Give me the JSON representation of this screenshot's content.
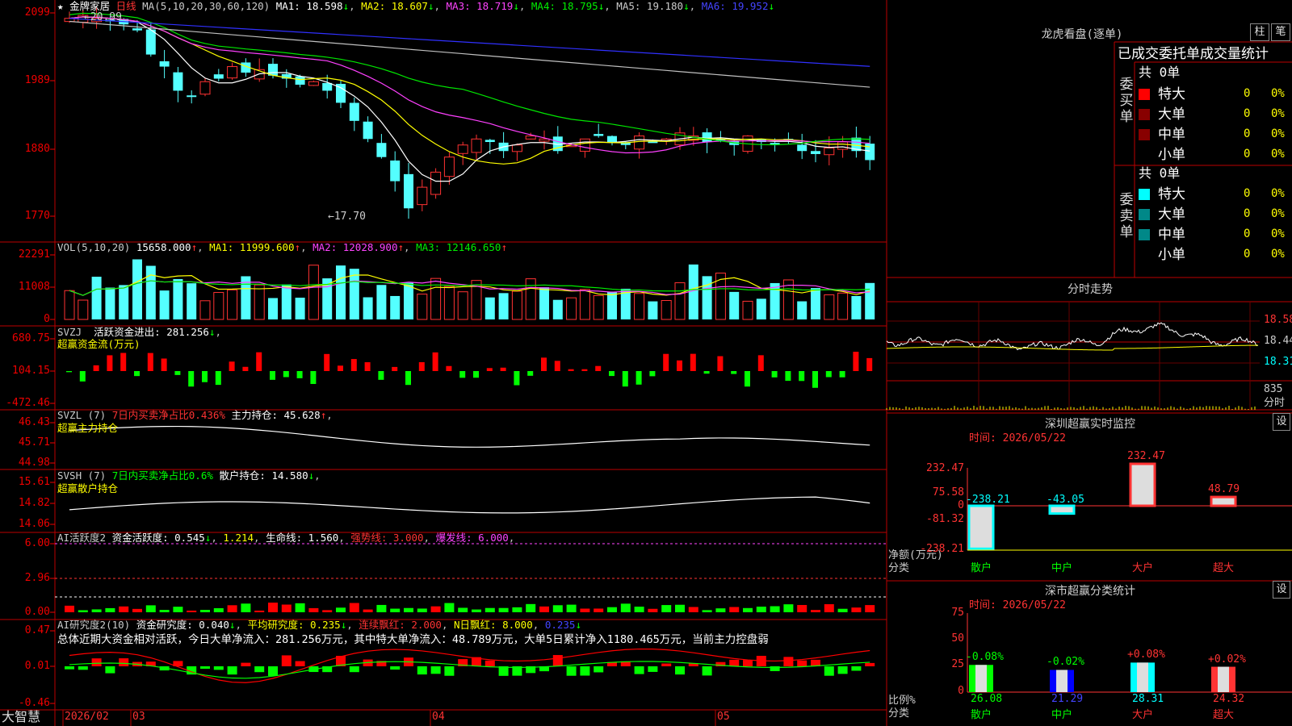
{
  "stock": {
    "name": "金牌家居",
    "period": "日线"
  },
  "main_legend": {
    "label": "MA(5,10,20,30,60,120)",
    "ma1": "MA1: 18.598",
    "ma2": "MA2: 18.607",
    "ma3": "MA3: 18.719",
    "ma4": "MA4: 18.795",
    "ma5": "MA5: 19.180",
    "ma6": "MA6: 19.952"
  },
  "price_axis": [
    "2099",
    "1989",
    "1880",
    "1770"
  ],
  "price_marks": {
    "high": "20.99",
    "low": "17.70"
  },
  "vol_legend": {
    "label": "VOL(5,10,20)",
    "value": "15658.000",
    "ma1": "MA1: 11999.600",
    "ma2": "MA2: 12028.900",
    "ma3": "MA3: 12146.650"
  },
  "vol_axis": [
    "22291",
    "11008",
    "0"
  ],
  "svzj": {
    "label": "SVZJ",
    "desc": "活跃资金进出: 281.256",
    "sub": "超赢资金流(万元)",
    "axis": [
      "680.75",
      "104.15",
      "-472.46"
    ]
  },
  "svzl": {
    "label": "SVZL (7)",
    "desc1": "7日内买卖净占比0.436%",
    "desc2": "主力持仓: 45.628",
    "sub": "超赢主力持仓",
    "axis": [
      "46.43",
      "45.71",
      "44.98"
    ]
  },
  "svsh": {
    "label": "SVSH (7)",
    "desc1": "7日内买卖净占比0.6%",
    "desc2": "散户持仓: 14.580",
    "sub": "超赢散户持仓",
    "axis": [
      "15.61",
      "14.82",
      "14.06"
    ]
  },
  "ai_active": {
    "label": "AI活跃度2",
    "desc1": "资金活跃度: 0.545",
    "desc2": "1.214",
    "desc3": "生命线: 1.560",
    "desc4": "强势线: 3.000",
    "desc5": "爆发线: 6.000",
    "axis": [
      "6.00",
      "2.96",
      "0.00"
    ]
  },
  "ai_research": {
    "label": "AI研究度2(10)",
    "desc1": "资金研究度: 0.040",
    "desc2": "平均研究度: 0.235",
    "desc3": "连续飘红: 2.000",
    "desc4": "N日飘红: 8.000",
    "desc5": "0.235",
    "summary": "总体近期大资金相对活跃，今日大单净流入：281.256万元，其中特大单净流入：48.789万元，大单5日累计净入1180.465万元，当前主力控盘弱",
    "axis": [
      "0.47",
      "0.01",
      "-0.46"
    ]
  },
  "bottom": {
    "brand": "大智慧",
    "date": "2026/02",
    "m03": "03",
    "m04": "04",
    "m05": "05"
  },
  "longhu": {
    "title": "龙虎看盘(逐单)",
    "btn1": "柱",
    "btn2": "笔",
    "header": "已成交委托单成交量统计",
    "buy_label": "委买单",
    "sell_label": "委卖单",
    "buy_total": "共 0单",
    "sell_total": "共 0单",
    "rows": [
      "特大",
      "大单",
      "中单",
      "小单"
    ],
    "zero": "0",
    "pct": "0%"
  },
  "fenshi": {
    "title": "分时走势",
    "axis": [
      "18.58",
      "18.44",
      "18.31"
    ],
    "vol_label": "835",
    "vol_unit": "分时"
  },
  "monitor": {
    "title": "深圳超赢实时监控",
    "btn": "设",
    "time": "时间: 2026/05/22",
    "axis": [
      "232.47",
      "75.58",
      "0",
      "-81.32",
      "-238.21"
    ],
    "unit": "净额(万元)",
    "xlabel": "分类"
  },
  "classify": {
    "title": "深市超赢分类统计",
    "btn": "设",
    "time": "时间: 2026/05/22",
    "axis": [
      "75",
      "50",
      "25",
      "0"
    ],
    "unit": "比例%",
    "xlabel": "分类"
  },
  "chart_data": [
    {
      "type": "bar",
      "title": "深圳超赢实时监控",
      "categories": [
        "散户",
        "中户",
        "大户",
        "超大"
      ],
      "values": [
        -238.21,
        -43.05,
        232.47,
        48.79
      ],
      "ylim": [
        -238.21,
        232.47
      ]
    },
    {
      "type": "bar",
      "title": "深市超赢分类统计",
      "categories": [
        "散户",
        "中户",
        "大户",
        "超大"
      ],
      "values": [
        26.08,
        21.29,
        28.31,
        24.32
      ],
      "changes": [
        "-0.08%",
        "-0.02%",
        "+0.08%",
        "+0.02%"
      ],
      "ylim": [
        0,
        75
      ]
    }
  ],
  "colors": {
    "up": "#ff3232",
    "down": "#54ffff",
    "ma1": "#ffffff",
    "ma2": "#ffff00",
    "ma3": "#ff40ff",
    "ma4": "#00e600",
    "ma5": "#c0c0c0",
    "ma6": "#3030ff"
  }
}
